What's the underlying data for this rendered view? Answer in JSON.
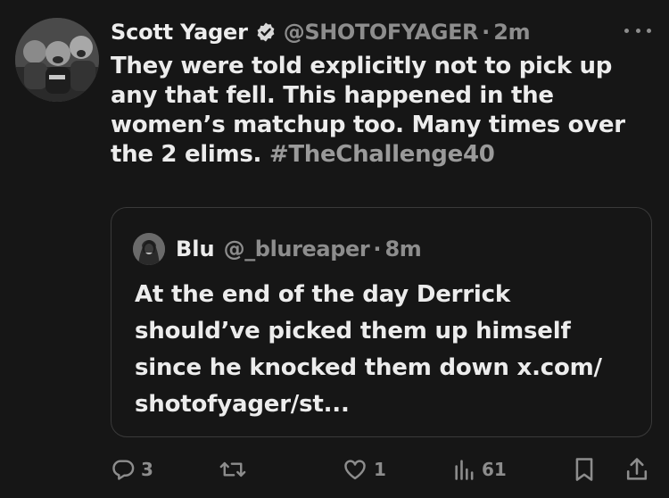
{
  "tweet": {
    "author_name": "Scott Yager",
    "handle": "@SHOTOFYAGER",
    "separator": "·",
    "time": "2m",
    "text_before_hashtag": "They were told explicitly not to pick up any that fell. This happened in the women’s matchup too. Many times over the 2 elims. ",
    "hashtag": "#TheChallenge40"
  },
  "quote": {
    "author_name": "Blu",
    "handle": "@_blureaper",
    "separator": "·",
    "time": "8m",
    "text": "At the end of the day Derrick should’ve picked them up himself since he knocked them down x.com/ shotofyager/st..."
  },
  "actions": {
    "reply_count": "3",
    "retweet_count": "",
    "like_count": "1",
    "views_count": "61"
  },
  "icons": {
    "verified": "verified-badge-icon",
    "more": "more-icon",
    "reply": "reply-icon",
    "retweet": "retweet-icon",
    "like": "heart-icon",
    "views": "views-icon",
    "bookmark": "bookmark-icon",
    "share": "share-icon"
  },
  "colors": {
    "background": "#161616",
    "text_primary": "#ececec",
    "text_secondary": "#8d8d8d",
    "hashtag": "#9a9a9a",
    "border": "#3a3a3a"
  }
}
